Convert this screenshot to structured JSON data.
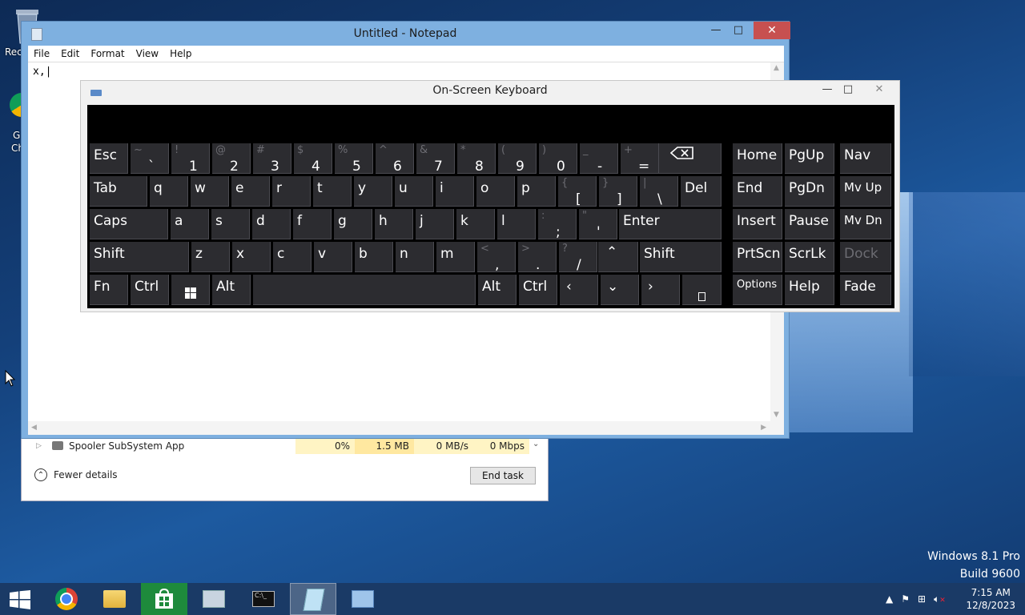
{
  "desktop": {
    "recycle_label": "Rec",
    "chrome_label_1": "G",
    "chrome_label_2": "Ch",
    "watermark_line1": "Windows 8.1 Pro",
    "watermark_line2": "Build 9600"
  },
  "taskmanager": {
    "process_name": "Spooler SubSystem App",
    "cpu": "0%",
    "memory": "1.5 MB",
    "disk": "0 MB/s",
    "network": "0 Mbps",
    "fewer_details": "Fewer details",
    "end_task": "End task"
  },
  "notepad": {
    "title": "Untitled - Notepad",
    "menu": [
      "File",
      "Edit",
      "Format",
      "View",
      "Help"
    ],
    "content": "x,|"
  },
  "osk": {
    "title": "On-Screen Keyboard",
    "keys": {
      "esc": "Esc",
      "tab": "Tab",
      "caps": "Caps",
      "shift_l": "Shift",
      "fn": "Fn",
      "ctrl_l": "Ctrl",
      "alt_l": "Alt",
      "q": "q",
      "w": "w",
      "e": "e",
      "r": "r",
      "t": "t",
      "y": "y",
      "u": "u",
      "i": "i",
      "o": "o",
      "p": "p",
      "a": "a",
      "s": "s",
      "d": "d",
      "f": "f",
      "g": "g",
      "h": "h",
      "j": "j",
      "k": "k",
      "l": "l",
      "z": "z",
      "x": "x",
      "c": "c",
      "v": "v",
      "b": "b",
      "n": "n",
      "m": "m",
      "del": "Del",
      "enter": "Enter",
      "shift_r": "Shift",
      "alt_r": "Alt",
      "ctrl_r": "Ctrl",
      "home": "Home",
      "pgup": "PgUp",
      "nav": "Nav",
      "end": "End",
      "pgdn": "PgDn",
      "mvup": "Mv Up",
      "insert": "Insert",
      "pause": "Pause",
      "mvdn": "Mv Dn",
      "prtscn": "PrtScn",
      "scrlk": "ScrLk",
      "dock": "Dock",
      "options": "Options",
      "help": "Help",
      "fade": "Fade"
    },
    "number_row": [
      {
        "sec": "~",
        "main": "`"
      },
      {
        "sec": "!",
        "main": "1"
      },
      {
        "sec": "@",
        "main": "2"
      },
      {
        "sec": "#",
        "main": "3"
      },
      {
        "sec": "$",
        "main": "4"
      },
      {
        "sec": "%",
        "main": "5"
      },
      {
        "sec": "^",
        "main": "6"
      },
      {
        "sec": "&",
        "main": "7"
      },
      {
        "sec": "*",
        "main": "8"
      },
      {
        "sec": "(",
        "main": "9"
      },
      {
        "sec": ")",
        "main": "0"
      },
      {
        "sec": "_",
        "main": "-"
      },
      {
        "sec": "+",
        "main": "="
      }
    ],
    "bracket_keys": [
      {
        "sec": "{",
        "main": "["
      },
      {
        "sec": "}",
        "main": "]"
      },
      {
        "sec": "|",
        "main": "\\"
      }
    ],
    "punct_row3": [
      {
        "sec": ":",
        "main": ";"
      },
      {
        "sec": "\"",
        "main": "'"
      }
    ],
    "punct_row4": [
      {
        "sec": "<",
        "main": ","
      },
      {
        "sec": ">",
        "main": "."
      },
      {
        "sec": "?",
        "main": "/"
      }
    ]
  },
  "taskbar": {
    "time": "7:15 AM",
    "date": "12/8/2023"
  }
}
